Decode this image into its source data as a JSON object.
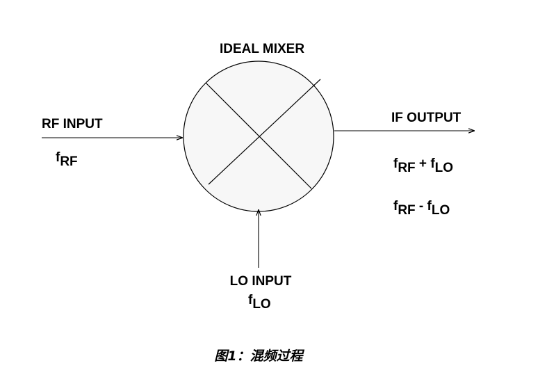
{
  "title": "IDEAL MIXER",
  "rf": {
    "label": "RF INPUT",
    "f": "f",
    "sub": "RF"
  },
  "lo": {
    "label": "LO INPUT",
    "f": "f",
    "sub": "LO"
  },
  "if": {
    "label": "IF OUTPUT",
    "sum": {
      "f1": "f",
      "sub1": "RF",
      "op": " + ",
      "f2": "f",
      "sub2": "LO"
    },
    "diff": {
      "f1": "f",
      "sub1": "RF",
      "op": " - ",
      "f2": "f",
      "sub2": "LO"
    }
  },
  "caption": "图1：混频过程",
  "colors": {
    "circle_fill": "#f7f7f7",
    "stroke": "#000000"
  }
}
